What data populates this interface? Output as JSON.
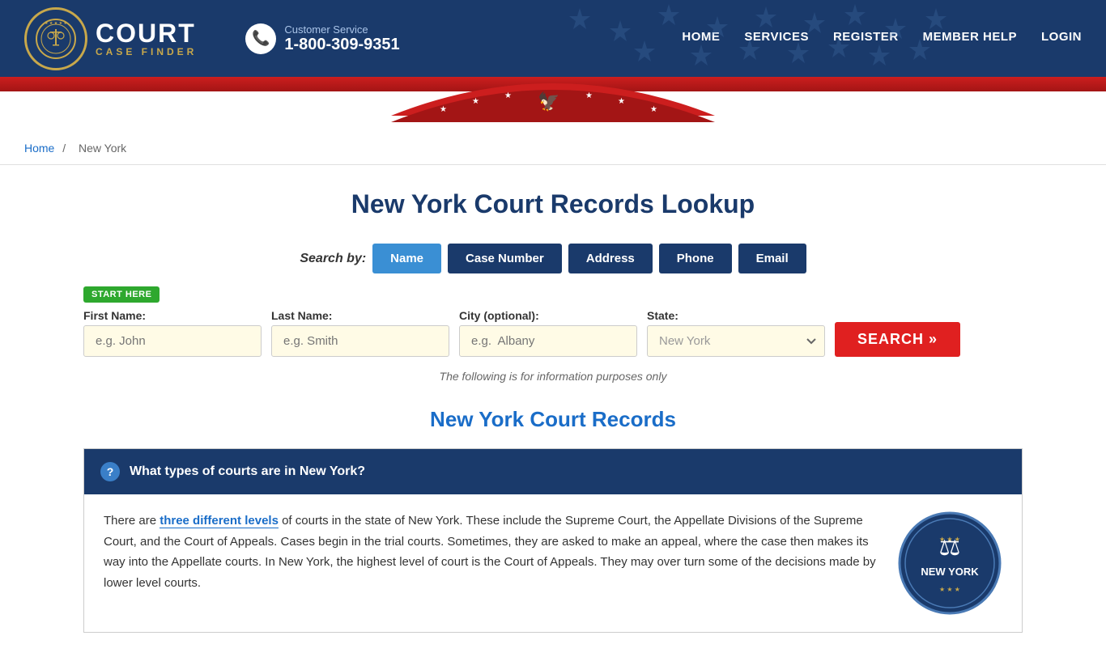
{
  "header": {
    "logo_court": "COURT",
    "logo_sub": "CASE FINDER",
    "customer_service_label": "Customer Service",
    "phone": "1-800-309-9351",
    "nav": [
      {
        "label": "HOME",
        "href": "#"
      },
      {
        "label": "SERVICES",
        "href": "#"
      },
      {
        "label": "REGISTER",
        "href": "#"
      },
      {
        "label": "MEMBER HELP",
        "href": "#"
      },
      {
        "label": "LOGIN",
        "href": "#"
      }
    ]
  },
  "breadcrumb": {
    "home": "Home",
    "separator": "/",
    "current": "New York"
  },
  "main": {
    "page_title": "New York Court Records Lookup",
    "search_by_label": "Search by:",
    "tabs": [
      {
        "label": "Name",
        "active": true
      },
      {
        "label": "Case Number",
        "active": false
      },
      {
        "label": "Address",
        "active": false
      },
      {
        "label": "Phone",
        "active": false
      },
      {
        "label": "Email",
        "active": false
      }
    ],
    "start_here": "START HERE",
    "fields": {
      "first_name_label": "First Name:",
      "first_name_placeholder": "e.g. John",
      "last_name_label": "Last Name:",
      "last_name_placeholder": "e.g. Smith",
      "city_label": "City (optional):",
      "city_placeholder": "e.g.  Albany",
      "state_label": "State:",
      "state_value": "New York"
    },
    "search_button": "SEARCH »",
    "info_note": "The following is for information purposes only",
    "section_title": "New York Court Records",
    "faq": {
      "question": "What types of courts are in New York?",
      "body": "There are three different levels of courts in the state of New York. These include the Supreme Court, the Appellate Divisions of the Supreme Court, and the Court of Appeals. Cases begin in the trial courts. Sometimes, they are asked to make an appeal, where the case then makes its way into the Appellate courts. In New York, the highest level of court is the Court of Appeals. They may over turn some of the decisions made by lower level courts.",
      "link_text": "three different levels"
    }
  }
}
